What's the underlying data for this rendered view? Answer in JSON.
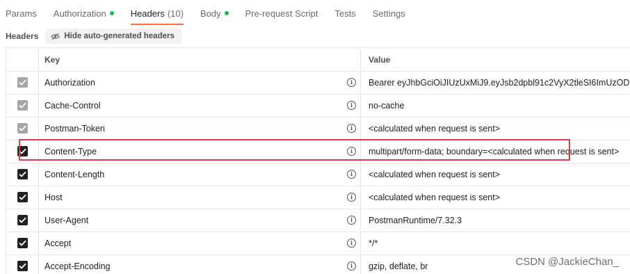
{
  "tabs": [
    {
      "label": "Params",
      "dot": false,
      "active": false
    },
    {
      "label": "Authorization",
      "dot": true,
      "active": false
    },
    {
      "label": "Headers",
      "count": "(10)",
      "dot": false,
      "active": true
    },
    {
      "label": "Body",
      "dot": true,
      "active": false
    },
    {
      "label": "Pre-request Script",
      "dot": false,
      "active": false
    },
    {
      "label": "Tests",
      "dot": false,
      "active": false
    },
    {
      "label": "Settings",
      "dot": false,
      "active": false
    }
  ],
  "subbar": {
    "title": "Headers",
    "hide_button": "Hide auto-generated headers",
    "hide_icon": "eye-off-icon"
  },
  "table": {
    "columns": {
      "key": "Key",
      "value": "Value"
    },
    "rows": [
      {
        "key": "Authorization",
        "value": "Bearer eyJhbGciOiJIUzUxMiJ9.eyJsb2dpbl91c2VyX2tleSI6ImUzOD",
        "checked": true,
        "auto": true
      },
      {
        "key": "Cache-Control",
        "value": "no-cache",
        "checked": true,
        "auto": true
      },
      {
        "key": "Postman-Token",
        "value": "<calculated when request is sent>",
        "checked": true,
        "auto": true
      },
      {
        "key": "Content-Type",
        "value": "multipart/form-data; boundary=<calculated when request is sent>",
        "checked": true,
        "auto": false,
        "highlighted": true
      },
      {
        "key": "Content-Length",
        "value": "<calculated when request is sent>",
        "checked": true,
        "auto": false
      },
      {
        "key": "Host",
        "value": "<calculated when request is sent>",
        "checked": true,
        "auto": false
      },
      {
        "key": "User-Agent",
        "value": "PostmanRuntime/7.32.3",
        "checked": true,
        "auto": false
      },
      {
        "key": "Accept",
        "value": "*/*",
        "checked": true,
        "auto": false
      },
      {
        "key": "Accept-Encoding",
        "value": "gzip, deflate, br",
        "checked": true,
        "auto": false
      }
    ]
  },
  "colors": {
    "accent": "#ff6c37",
    "status_dot": "#0cbb52",
    "highlight_border": "#e03d3d",
    "checkbox_on": "#212121",
    "checkbox_disabled": "#a6a6a6"
  },
  "watermark": "CSDN @JackieChan_"
}
